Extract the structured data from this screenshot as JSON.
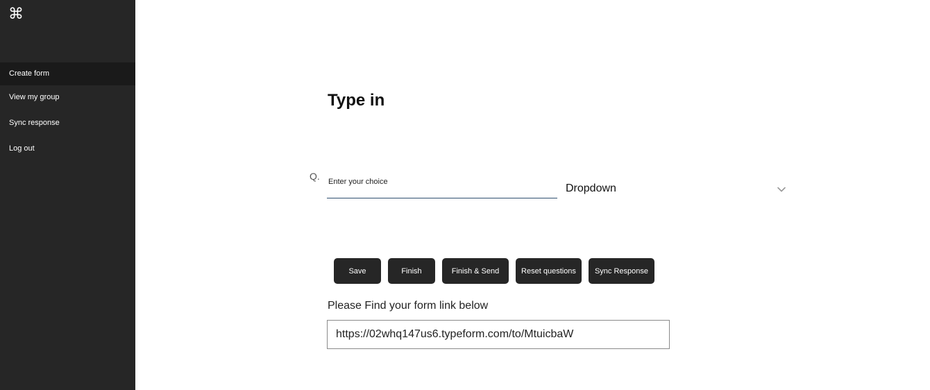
{
  "sidebar": {
    "logo": "⌘",
    "items": [
      {
        "label": "Create form"
      },
      {
        "label": "View my group"
      },
      {
        "label": "Sync response"
      },
      {
        "label": "Log out"
      }
    ]
  },
  "main": {
    "title": "Type in",
    "question_prefix": "Q.",
    "choice_input": {
      "value": "",
      "placeholder": "Enter your choice"
    },
    "dropdown": {
      "selected": "Dropdown",
      "icon": "chevron-down-icon"
    },
    "buttons": {
      "save": "Save",
      "finish": "Finish",
      "finish_send": "Finish & Send",
      "reset": "Reset questions",
      "sync": "Sync Response"
    },
    "link_caption": "Please Find your form link below",
    "form_link": "https://02whq147us6.typeform.com/to/MtuicbaW"
  },
  "colors": {
    "sidebar_bg": "#262626",
    "button_bg": "#262626",
    "input_underline": "#2f4f6f"
  }
}
